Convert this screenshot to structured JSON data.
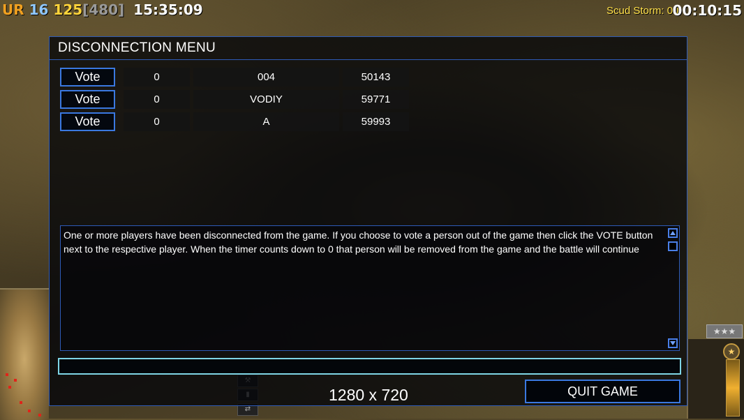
{
  "hud": {
    "faction": "UR",
    "level": "16",
    "money": "125",
    "money_cap": "[480]",
    "clock": "15:35:09",
    "superweapon_label": "Scud Storm: 00",
    "superweapon_timer": "00:10:15"
  },
  "background": {
    "rank_stars": "★★★",
    "rank_icon": "star-icon"
  },
  "dialog": {
    "title": "DISCONNECTION MENU",
    "players": [
      {
        "vote_label": "Vote",
        "votes": "0",
        "name": "004",
        "ping": "50143"
      },
      {
        "vote_label": "Vote",
        "votes": "0",
        "name": "VODIY",
        "ping": "59771"
      },
      {
        "vote_label": "Vote",
        "votes": "0",
        "name": "A",
        "ping": "59993"
      }
    ],
    "message": "One or more players have been disconnected from the game. If you choose to vote a person out of the game then click the VOTE button next to the respective player. When the timer counts down to 0 that person will be removed from the game and the battle will continue",
    "chat_input_value": "",
    "quit_label": "QUIT GAME"
  },
  "resolution_label": "1280 x 720"
}
